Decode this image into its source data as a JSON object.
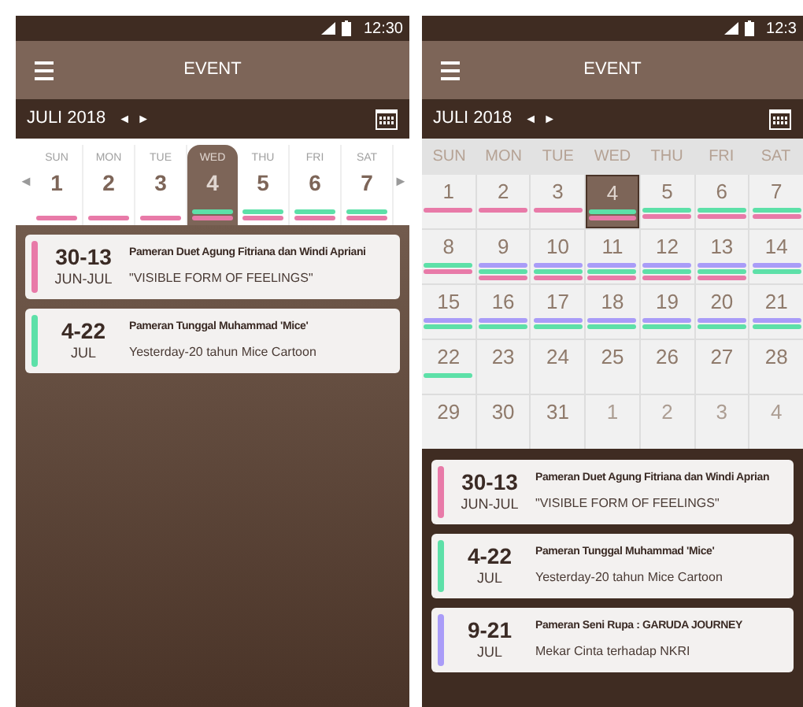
{
  "screens": [
    {
      "kind": "week",
      "status_bar": {
        "time": "12:30"
      },
      "toolbar": {
        "title": "EVENT"
      },
      "month": {
        "label": "JULI 2018",
        "prev": "◄",
        "next": "►"
      },
      "week": {
        "prev": "◄",
        "next": "►",
        "days": [
          {
            "weekday": "SUN",
            "day": "1",
            "selected": false,
            "bars": [
              {
                "color": "#e87aa8"
              }
            ]
          },
          {
            "weekday": "MON",
            "day": "2",
            "selected": false,
            "bars": [
              {
                "color": "#e87aa8"
              }
            ]
          },
          {
            "weekday": "TUE",
            "day": "3",
            "selected": false,
            "bars": [
              {
                "color": "#e87aa8"
              }
            ]
          },
          {
            "weekday": "WED",
            "day": "4",
            "selected": true,
            "bars": [
              {
                "color": "#5de0a8"
              },
              {
                "color": "#e87aa8"
              }
            ]
          },
          {
            "weekday": "THU",
            "day": "5",
            "selected": false,
            "bars": [
              {
                "color": "#5de0a8"
              },
              {
                "color": "#e87aa8"
              }
            ]
          },
          {
            "weekday": "FRI",
            "day": "6",
            "selected": false,
            "bars": [
              {
                "color": "#5de0a8"
              },
              {
                "color": "#e87aa8"
              }
            ]
          },
          {
            "weekday": "SAT",
            "day": "7",
            "selected": false,
            "bars": [
              {
                "color": "#5de0a8"
              },
              {
                "color": "#e87aa8"
              }
            ]
          }
        ]
      },
      "events": [
        {
          "date": "30-13",
          "months": "JUN-JUL",
          "title": "Pameran Duet Agung Fitriana dan Windi Apriani",
          "subtitle": "\"VISIBLE FORM OF FEELINGS\"",
          "color": "#e87aa8"
        },
        {
          "date": "4-22",
          "months": "JUL",
          "title": "Pameran Tunggal Muhammad 'Mice'",
          "subtitle": "Yesterday-20 tahun Mice Cartoon",
          "color": "#5de0a8"
        }
      ]
    },
    {
      "kind": "month",
      "status_bar": {
        "time": "12:3"
      },
      "toolbar": {
        "title": "EVENT"
      },
      "month": {
        "label": "JULI 2018",
        "prev": "◄",
        "next": "►"
      },
      "weekdays": [
        "SUN",
        "MON",
        "TUE",
        "WED",
        "THU",
        "FRI",
        "SAT"
      ],
      "days": [
        {
          "day": "1",
          "selected": false,
          "outside": false,
          "bars": [
            {
              "color": "#e87aa8"
            }
          ]
        },
        {
          "day": "2",
          "selected": false,
          "outside": false,
          "bars": [
            {
              "color": "#e87aa8"
            }
          ]
        },
        {
          "day": "3",
          "selected": false,
          "outside": false,
          "bars": [
            {
              "color": "#e87aa8"
            }
          ]
        },
        {
          "day": "4",
          "selected": true,
          "outside": false,
          "bars": [
            {
              "color": "#5de0a8"
            },
            {
              "color": "#e87aa8"
            }
          ]
        },
        {
          "day": "5",
          "selected": false,
          "outside": false,
          "bars": [
            {
              "color": "#5de0a8"
            },
            {
              "color": "#e87aa8"
            }
          ]
        },
        {
          "day": "6",
          "selected": false,
          "outside": false,
          "bars": [
            {
              "color": "#5de0a8"
            },
            {
              "color": "#e87aa8"
            }
          ]
        },
        {
          "day": "7",
          "selected": false,
          "outside": false,
          "bars": [
            {
              "color": "#5de0a8"
            },
            {
              "color": "#e87aa8"
            }
          ]
        },
        {
          "day": "8",
          "selected": false,
          "outside": false,
          "bars": [
            {
              "color": "#5de0a8"
            },
            {
              "color": "#e87aa8"
            }
          ]
        },
        {
          "day": "9",
          "selected": false,
          "outside": false,
          "bars": [
            {
              "color": "#a99cf8"
            },
            {
              "color": "#5de0a8"
            },
            {
              "color": "#e87aa8"
            }
          ]
        },
        {
          "day": "10",
          "selected": false,
          "outside": false,
          "bars": [
            {
              "color": "#a99cf8"
            },
            {
              "color": "#5de0a8"
            },
            {
              "color": "#e87aa8"
            }
          ]
        },
        {
          "day": "11",
          "selected": false,
          "outside": false,
          "bars": [
            {
              "color": "#a99cf8"
            },
            {
              "color": "#5de0a8"
            },
            {
              "color": "#e87aa8"
            }
          ]
        },
        {
          "day": "12",
          "selected": false,
          "outside": false,
          "bars": [
            {
              "color": "#a99cf8"
            },
            {
              "color": "#5de0a8"
            },
            {
              "color": "#e87aa8"
            }
          ]
        },
        {
          "day": "13",
          "selected": false,
          "outside": false,
          "bars": [
            {
              "color": "#a99cf8"
            },
            {
              "color": "#5de0a8"
            },
            {
              "color": "#e87aa8"
            }
          ]
        },
        {
          "day": "14",
          "selected": false,
          "outside": false,
          "bars": [
            {
              "color": "#a99cf8"
            },
            {
              "color": "#5de0a8"
            }
          ]
        },
        {
          "day": "15",
          "selected": false,
          "outside": false,
          "bars": [
            {
              "color": "#a99cf8"
            },
            {
              "color": "#5de0a8"
            }
          ]
        },
        {
          "day": "16",
          "selected": false,
          "outside": false,
          "bars": [
            {
              "color": "#a99cf8"
            },
            {
              "color": "#5de0a8"
            }
          ]
        },
        {
          "day": "17",
          "selected": false,
          "outside": false,
          "bars": [
            {
              "color": "#a99cf8"
            },
            {
              "color": "#5de0a8"
            }
          ]
        },
        {
          "day": "18",
          "selected": false,
          "outside": false,
          "bars": [
            {
              "color": "#a99cf8"
            },
            {
              "color": "#5de0a8"
            }
          ]
        },
        {
          "day": "19",
          "selected": false,
          "outside": false,
          "bars": [
            {
              "color": "#a99cf8"
            },
            {
              "color": "#5de0a8"
            }
          ]
        },
        {
          "day": "20",
          "selected": false,
          "outside": false,
          "bars": [
            {
              "color": "#a99cf8"
            },
            {
              "color": "#5de0a8"
            }
          ]
        },
        {
          "day": "21",
          "selected": false,
          "outside": false,
          "bars": [
            {
              "color": "#a99cf8"
            },
            {
              "color": "#5de0a8"
            }
          ]
        },
        {
          "day": "22",
          "selected": false,
          "outside": false,
          "bars": [
            {
              "color": "#5de0a8"
            }
          ]
        },
        {
          "day": "23",
          "selected": false,
          "outside": false
        },
        {
          "day": "24",
          "selected": false,
          "outside": false
        },
        {
          "day": "25",
          "selected": false,
          "outside": false
        },
        {
          "day": "26",
          "selected": false,
          "outside": false
        },
        {
          "day": "27",
          "selected": false,
          "outside": false
        },
        {
          "day": "28",
          "selected": false,
          "outside": false
        },
        {
          "day": "29",
          "selected": false,
          "outside": false
        },
        {
          "day": "30",
          "selected": false,
          "outside": false
        },
        {
          "day": "31",
          "selected": false,
          "outside": false
        },
        {
          "day": "1",
          "selected": false,
          "outside": true
        },
        {
          "day": "2",
          "selected": false,
          "outside": true
        },
        {
          "day": "3",
          "selected": false,
          "outside": true
        },
        {
          "day": "4",
          "selected": false,
          "outside": true
        }
      ],
      "events": [
        {
          "date": "30-13",
          "months": "JUN-JUL",
          "title": "Pameran Duet Agung Fitriana dan Windi Aprian",
          "subtitle": "\"VISIBLE FORM OF FEELINGS\"",
          "color": "#e87aa8"
        },
        {
          "date": "4-22",
          "months": "JUL",
          "title": "Pameran Tunggal Muhammad 'Mice'",
          "subtitle": "Yesterday-20 tahun Mice Cartoon",
          "color": "#5de0a8"
        },
        {
          "date": "9-21",
          "months": "JUL",
          "title": "Pameran Seni Rupa : GARUDA JOURNEY",
          "subtitle": "Mekar Cinta terhadap NKRI",
          "color": "#a99cf8"
        }
      ]
    }
  ]
}
